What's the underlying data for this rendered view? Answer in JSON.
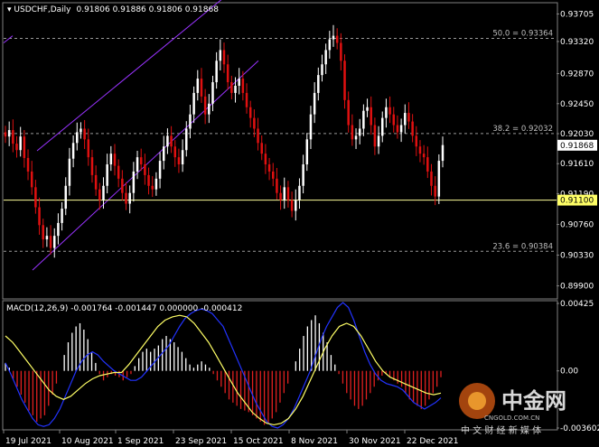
{
  "window": {
    "symbol_title": "USDCHF,Daily",
    "ohlc": "0.91806 0.91886 0.91806 0.91868"
  },
  "macd": {
    "title": "MACD(12,26,9) -0.001764 -0.001447 0.000000 -0.000412"
  },
  "watermark": {
    "brand": "中金网",
    "slogan": "中 文 财 经 新 媒 体",
    "url": "CNGOLD.COM.CN"
  },
  "colors": {
    "bull": "#ffffff",
    "bear": "#e01010",
    "channel": "#9933ff",
    "hline": "#ffff99",
    "fib": "#9a9a9a",
    "macd_hist": "#ffffff",
    "macd_neg_hist": "#e02020",
    "macd_line": "#2233ff",
    "signal_line": "#ffff66",
    "price_marker_bg": "#ffffff",
    "level_marker_bg": "#ffff66"
  },
  "chart_data": [
    {
      "type": "candlestick",
      "title": "USDCHF,Daily",
      "ylim": [
        0.8973,
        0.9385
      ],
      "ticks_y": [
        "0.93705",
        "0.93320",
        "0.92870",
        "0.92450",
        "0.92030",
        "0.91610",
        "0.91190",
        "0.90760",
        "0.90330",
        "0.89900"
      ],
      "ticks_x": [
        "19 Jul 2021",
        "10 Aug 2021",
        "1 Sep 2021",
        "23 Sep 2021",
        "15 Oct 2021",
        "8 Nov 2021",
        "30 Nov 2021",
        "22 Dec 2021"
      ],
      "current_price": {
        "value": 0.91868,
        "label": "0.91868"
      },
      "horizontal_line": {
        "value": 0.911,
        "label": "0.91100"
      },
      "fibonacci": [
        {
          "label": "50.0 = 0.93364",
          "value": 0.93364
        },
        {
          "label": "38.2 = 0.92032",
          "value": 0.92032
        },
        {
          "label": "23.6 = 0.90384",
          "value": 0.90384
        }
      ],
      "channel": {
        "upper": [
          [
            0.9179,
            0.9245
          ],
          [
            0.9382,
            0.9404
          ]
        ],
        "lower": [
          [
            0.9012,
            0.9022
          ],
          [
            0.9267,
            0.9305
          ]
        ]
      },
      "closes": [
        0.9199,
        0.9208,
        0.9189,
        0.918,
        0.9199,
        0.9169,
        0.915,
        0.9128,
        0.91,
        0.9075,
        0.9055,
        0.906,
        0.9043,
        0.906,
        0.9078,
        0.9098,
        0.913,
        0.9168,
        0.919,
        0.9205,
        0.921,
        0.9195,
        0.917,
        0.9145,
        0.9125,
        0.911,
        0.913,
        0.916,
        0.9175,
        0.9158,
        0.914,
        0.912,
        0.9105,
        0.912,
        0.915,
        0.917,
        0.916,
        0.9145,
        0.913,
        0.9125,
        0.914,
        0.9165,
        0.9185,
        0.92,
        0.9185,
        0.917,
        0.916,
        0.918,
        0.921,
        0.923,
        0.926,
        0.928,
        0.9255,
        0.923,
        0.9245,
        0.9275,
        0.9305,
        0.932,
        0.93,
        0.9275,
        0.926,
        0.927,
        0.928,
        0.926,
        0.924,
        0.9225,
        0.921,
        0.919,
        0.9175,
        0.916,
        0.915,
        0.914,
        0.912,
        0.911,
        0.9128,
        0.911,
        0.9095,
        0.911,
        0.913,
        0.916,
        0.9195,
        0.923,
        0.926,
        0.9285,
        0.93,
        0.932,
        0.9335,
        0.934,
        0.933,
        0.9305,
        0.925,
        0.9215,
        0.9195,
        0.92,
        0.921,
        0.9235,
        0.924,
        0.9215,
        0.9185,
        0.92,
        0.9225,
        0.924,
        0.923,
        0.9215,
        0.9205,
        0.9215,
        0.9232,
        0.922,
        0.92,
        0.9185,
        0.9175,
        0.917,
        0.915,
        0.913,
        0.9115,
        0.9165,
        0.9187
      ]
    },
    {
      "type": "bar",
      "title": "MACD(12,26,9) -0.001764 -0.001447 0.000000 -0.000412",
      "ylim": [
        -0.003602,
        0.00425
      ],
      "ticks_y": [
        "0.00425",
        "0.00",
        "-0.003602"
      ],
      "macd_hist": [
        0.0005,
        0.0002,
        -0.0005,
        -0.001,
        -0.0015,
        -0.002,
        -0.0025,
        -0.0028,
        -0.0032,
        -0.003,
        -0.0028,
        -0.0022,
        -0.0015,
        -0.0008,
        0.0,
        0.001,
        0.0018,
        0.0024,
        0.0028,
        0.003,
        0.0026,
        0.002,
        0.0012,
        0.0005,
        -0.0002,
        -0.0006,
        -0.0004,
        -0.0002,
        -0.0003,
        -0.0004,
        -0.0006,
        -0.0004,
        -0.0002,
        0.0003,
        0.0008,
        0.0012,
        0.0014,
        0.0012,
        0.0014,
        0.0016,
        0.002,
        0.0022,
        0.002,
        0.0018,
        0.0015,
        0.0012,
        0.0008,
        0.0004,
        0.0002,
        0.0004,
        0.0006,
        0.0004,
        0.0002,
        -0.0002,
        -0.0006,
        -0.001,
        -0.0014,
        -0.0018,
        -0.002,
        -0.0022,
        -0.0024,
        -0.0025,
        -0.0026,
        -0.0028,
        -0.003,
        -0.0032,
        -0.0034,
        -0.0033,
        -0.003,
        -0.0026,
        -0.002,
        -0.0014,
        -0.0008,
        0.0,
        0.0006,
        0.0014,
        0.0022,
        0.0028,
        0.0032,
        0.0035,
        0.003,
        0.0024,
        0.0018,
        0.001,
        0.0004,
        -0.0002,
        -0.0008,
        -0.0014,
        -0.0018,
        -0.0022,
        -0.0024,
        -0.0022,
        -0.0018,
        -0.0014,
        -0.001,
        -0.0006,
        -0.0003,
        -0.0002,
        -0.0004,
        -0.0006,
        -0.0008,
        -0.001,
        -0.0014,
        -0.0018,
        -0.002,
        -0.0022,
        -0.0024,
        -0.0022,
        -0.0018,
        -0.0014,
        -0.001,
        -0.0004
      ],
      "macd_line": [
        0.0005,
        -0.0002,
        -0.001,
        -0.0018,
        -0.0024,
        -0.003,
        -0.0034,
        -0.0035,
        -0.0034,
        -0.003,
        -0.0024,
        -0.0016,
        -0.0008,
        0.0,
        0.0006,
        0.001,
        0.0012,
        0.001,
        0.0006,
        0.0003,
        0.0,
        -0.0002,
        -0.0004,
        -0.0006,
        -0.0006,
        -0.0004,
        0.0,
        0.0004,
        0.0008,
        0.0012,
        0.0016,
        0.0022,
        0.0028,
        0.0033,
        0.0036,
        0.0038,
        0.0039,
        0.0038,
        0.0036,
        0.0032,
        0.0028,
        0.002,
        0.0012,
        0.0004,
        -0.0004,
        -0.0012,
        -0.002,
        -0.0026,
        -0.0032,
        -0.0035,
        -0.0036,
        -0.0034,
        -0.003,
        -0.0024,
        -0.0016,
        -0.0008,
        0.0,
        0.001,
        0.002,
        0.0028,
        0.0034,
        0.004,
        0.0043,
        0.004,
        0.0032,
        0.0022,
        0.0012,
        0.0004,
        -0.0002,
        -0.0006,
        -0.0008,
        -0.0009,
        -0.001,
        -0.0012,
        -0.0016,
        -0.002,
        -0.0022,
        -0.0024,
        -0.0022,
        -0.002,
        -0.0017
      ],
      "signal_line": [
        0.0022,
        0.0018,
        0.0012,
        0.0006,
        0.0,
        -0.0006,
        -0.0012,
        -0.0016,
        -0.0018,
        -0.0016,
        -0.0012,
        -0.0008,
        -0.0005,
        -0.0003,
        -0.0002,
        -0.0001,
        -0.0001,
        0.0004,
        0.001,
        0.0016,
        0.0022,
        0.0028,
        0.0032,
        0.0034,
        0.0035,
        0.0034,
        0.003,
        0.0024,
        0.0018,
        0.001,
        0.0002,
        -0.0006,
        -0.0014,
        -0.002,
        -0.0026,
        -0.003,
        -0.0033,
        -0.0034,
        -0.0033,
        -0.003,
        -0.0024,
        -0.0016,
        -0.0006,
        0.0004,
        0.0014,
        0.0022,
        0.0028,
        0.003,
        0.0028,
        0.0022,
        0.0014,
        0.0006,
        0.0,
        -0.0004,
        -0.0006,
        -0.0008,
        -0.001,
        -0.0012,
        -0.0014,
        -0.0015,
        -0.0014
      ]
    }
  ]
}
